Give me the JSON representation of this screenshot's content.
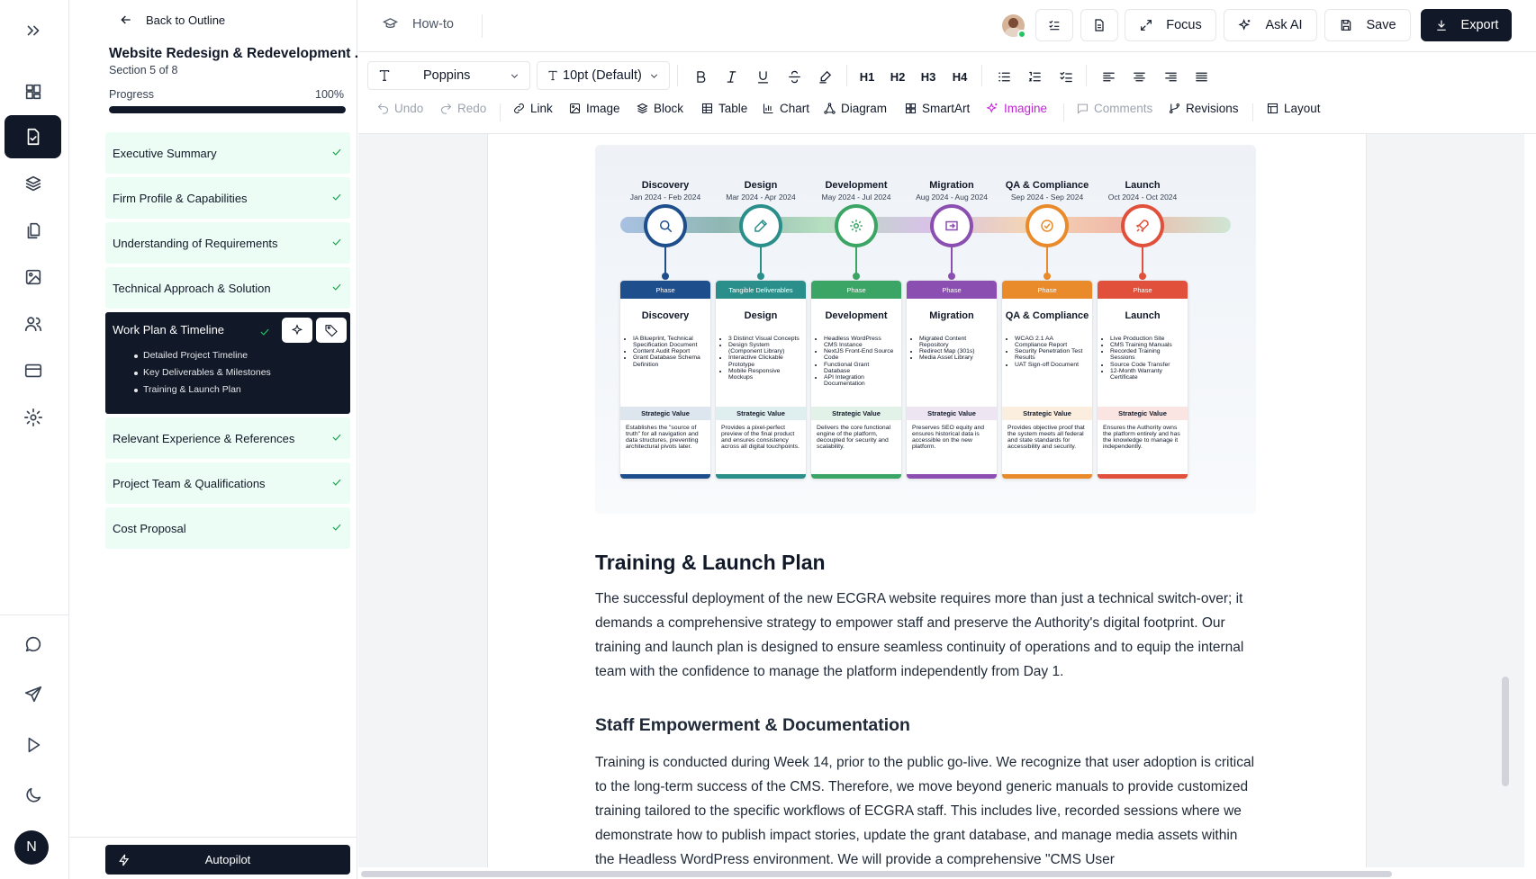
{
  "outline": {
    "back_label": "Back to Outline",
    "doc_title": "Website Redesign & Redevelopment ...",
    "section_count": "Section 5 of 8",
    "progress_label": "Progress",
    "progress_value": "100%",
    "progress_fraction": 1.0,
    "sections": [
      {
        "label": "Executive Summary",
        "done": true
      },
      {
        "label": "Firm Profile & Capabilities",
        "done": true
      },
      {
        "label": "Understanding of Requirements",
        "done": true
      },
      {
        "label": "Technical Approach & Solution",
        "done": true
      },
      {
        "label": "Work Plan & Timeline",
        "done": true,
        "active": true,
        "subsections": [
          "Detailed Project Timeline",
          "Key Deliverables & Milestones",
          "Training & Launch Plan"
        ]
      },
      {
        "label": "Relevant Experience & References",
        "done": true
      },
      {
        "label": "Project Team & Qualifications",
        "done": true
      },
      {
        "label": "Cost Proposal",
        "done": true
      }
    ],
    "autopilot_label": "Autopilot"
  },
  "rail": {
    "items": [
      "dashboard-icon",
      "document-icon",
      "layers-icon",
      "copy-icon",
      "image-icon",
      "users-icon",
      "billing-card-icon",
      "settings-icon"
    ],
    "bottom": [
      "chat-icon",
      "send-icon",
      "play-icon",
      "moon-icon"
    ],
    "avatar_initial": "N"
  },
  "header": {
    "howto_label": "How-to",
    "focus_label": "Focus",
    "ask_ai_label": "Ask AI",
    "save_label": "Save",
    "export_label": "Export"
  },
  "toolbar": {
    "font_family": "Poppins",
    "font_size": "10pt (Default)",
    "headings": [
      "H1",
      "H2",
      "H3",
      "H4"
    ],
    "undo": "Undo",
    "redo": "Redo",
    "link": "Link",
    "image": "Image",
    "block": "Block",
    "table": "Table",
    "chart": "Chart",
    "diagram": "Diagram",
    "smartart": "SmartArt",
    "imagine": "Imagine",
    "comments": "Comments",
    "revisions": "Revisions",
    "layout": "Layout"
  },
  "infographic": {
    "phases": [
      {
        "name": "Discovery",
        "dates": "Jan 2024 - Feb 2024",
        "bar": "Phase",
        "card_title": "Discovery",
        "color": "#1e4e8c",
        "items": [
          "IA Blueprint, Technical Specification Document",
          "Content Audit Report",
          "Grant Database Schema Definition"
        ],
        "value_title": "Strategic Value",
        "value_text": "Establishes the \"source of truth\" for all navigation and data structures, preventing architectural pivots later."
      },
      {
        "name": "Design",
        "dates": "Mar 2024 - Apr 2024",
        "bar": "Tangible Deliverables",
        "card_title": "Design",
        "color": "#2a8f8a",
        "items": [
          "3 Distinct Visual Concepts",
          "Design System (Component Library)",
          "Interactive Clickable Prototype",
          "Mobile Responsive Mockups"
        ],
        "value_title": "Strategic Value",
        "value_text": "Provides a pixel-perfect preview of the final product and ensures consistency across all digital touchpoints."
      },
      {
        "name": "Development",
        "dates": "May 2024 - Jul 2024",
        "bar": "Phase",
        "card_title": "Development",
        "color": "#3aa564",
        "items": [
          "Headless WordPress CMS Instance",
          "NextJS Front-End Source Code",
          "Functional Grant Database",
          "API Integration Documentation"
        ],
        "value_title": "Strategic Value",
        "value_text": "Delivers the core functional engine of the platform, decoupled for security and scalability."
      },
      {
        "name": "Migration",
        "dates": "Aug 2024 - Aug 2024",
        "bar": "Phase",
        "card_title": "Migration",
        "color": "#8a4fb0",
        "items": [
          "Migrated Content Repository",
          "Redirect Map (301s)",
          "Media Asset Library"
        ],
        "value_title": "Strategic Value",
        "value_text": "Preserves SEO equity and ensures historical data is accessible on the new platform."
      },
      {
        "name": "QA & Compliance",
        "dates": "Sep 2024 - Sep 2024",
        "bar": "Phase",
        "card_title": "QA & Compliance",
        "color": "#e98a2b",
        "items": [
          "WCAG 2.1 AA Compliance Report",
          "Security Penetration Test Results",
          "UAT Sign-off Document"
        ],
        "value_title": "Strategic Value",
        "value_text": "Provides objective proof that the system meets all federal and state standards for accessibility and security."
      },
      {
        "name": "Launch",
        "dates": "Oct 2024 - Oct 2024",
        "bar": "Phase",
        "card_title": "Launch",
        "color": "#e0503a",
        "items": [
          "Live Production Site",
          "CMS Training Manuals",
          "Recorded Training Sessions",
          "Source Code Transfer",
          "12-Month Warranty Certificate"
        ],
        "value_title": "Strategic Value",
        "value_text": "Ensures the Authority owns the platform entirely and has the knowledge to manage it independently."
      }
    ]
  },
  "document": {
    "h_training": "Training & Launch Plan",
    "p_training": "The successful deployment of the new ECGRA website requires more than just a technical switch-over; it demands a comprehensive strategy to empower staff and preserve the Authority's digital footprint. Our training and launch plan is designed to ensure seamless continuity of operations and to equip the internal team with the confidence to manage the platform independently from Day 1.",
    "h_staff": "Staff Empowerment & Documentation",
    "p_staff": "Training is conducted during Week 14, prior to the public go-live. We recognize that user adoption is critical to the long-term success of the CMS. Therefore, we move beyond generic manuals to provide customized training tailored to the specific workflows of ECGRA staff. This includes live, recorded sessions where we demonstrate how to publish impact stories, update the grant database, and manage media assets within the Headless WordPress environment. We will provide a comprehensive \"CMS User"
  }
}
